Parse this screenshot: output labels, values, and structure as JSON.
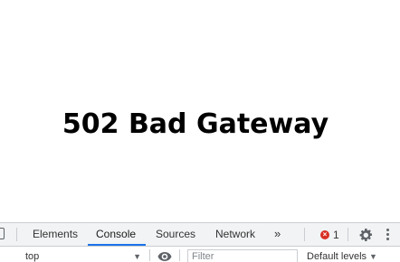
{
  "page": {
    "heading": "502 Bad Gateway"
  },
  "devtools": {
    "tabs": [
      {
        "label": "Elements",
        "active": false
      },
      {
        "label": "Console",
        "active": true
      },
      {
        "label": "Sources",
        "active": false
      },
      {
        "label": "Network",
        "active": false
      }
    ],
    "more_tabs_glyph": "»",
    "error_count": "1",
    "error_icon_glyph": "×",
    "icons": {
      "device_toggle": "device-toolbar-icon",
      "error": "error-icon",
      "settings": "gear-icon",
      "more": "kebab-menu-icon",
      "live_expression": "eye-icon"
    },
    "colors": {
      "active_tab_underline": "#1a73e8",
      "error": "#d93025"
    },
    "console_toolbar": {
      "context": "top",
      "context_caret": "▼",
      "filter_placeholder": "Filter",
      "filter_value": "",
      "levels_label": "Default levels",
      "levels_caret": "▼"
    }
  }
}
